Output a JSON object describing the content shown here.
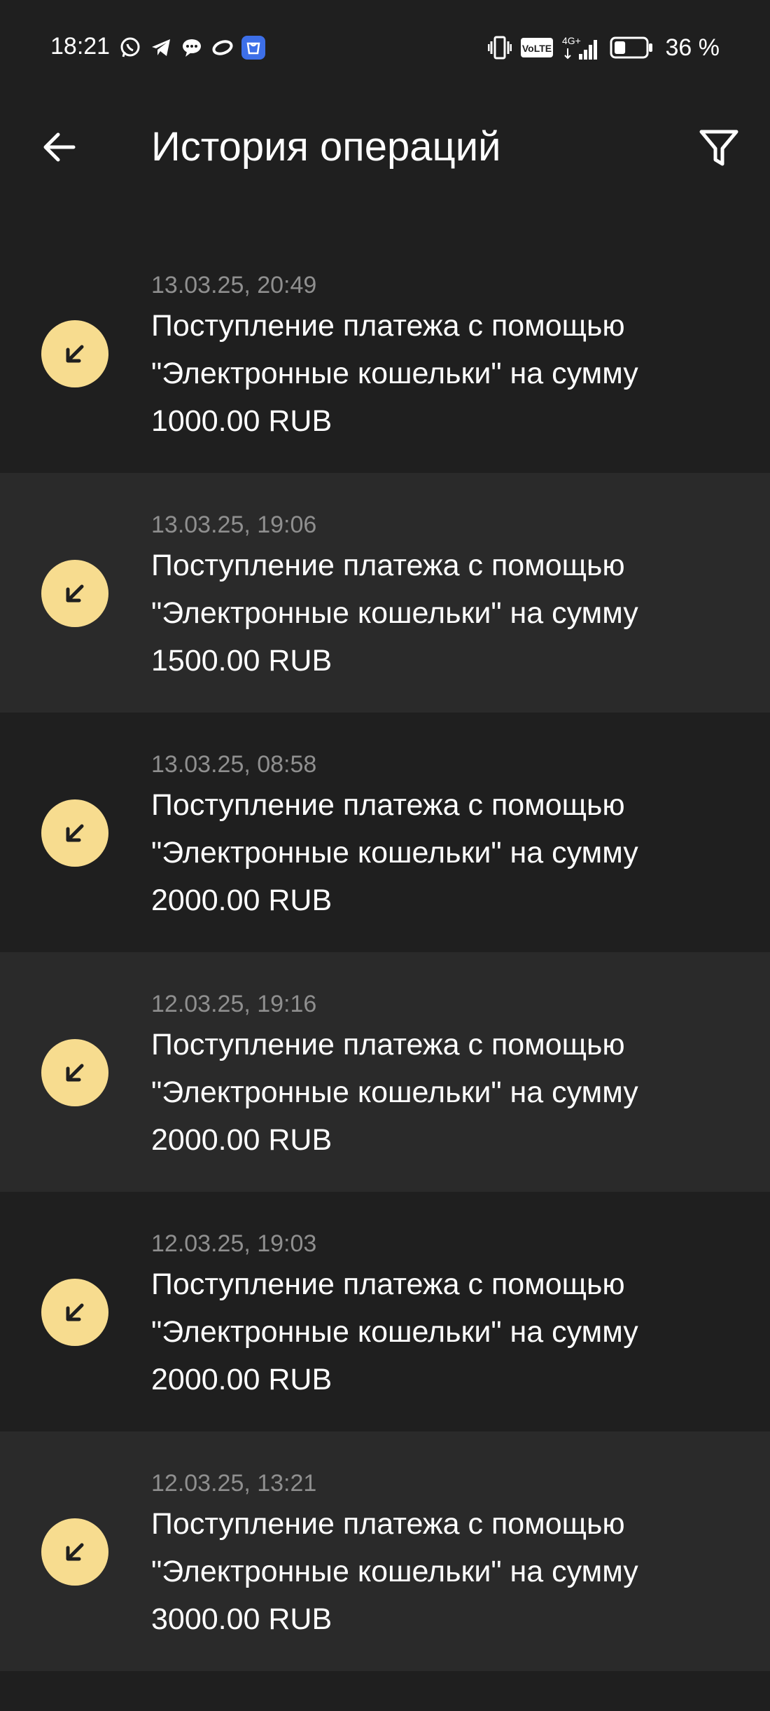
{
  "status_bar": {
    "time": "18:21",
    "left_icons": [
      "whatsapp-icon",
      "telegram-icon",
      "chat-bubble-icon",
      "ring-icon",
      "app-store-icon"
    ],
    "right_icons": [
      "vibrate-icon",
      "volte-icon",
      "4g-signal-icon",
      "battery-icon"
    ],
    "volte_label": "VoLTE",
    "network_label": "4G+",
    "battery_percent": "36 %",
    "battery_level": 0.36
  },
  "app_bar": {
    "title": "История операций",
    "back_icon": "arrow-left-icon",
    "filter_icon": "filter-icon"
  },
  "operations": [
    {
      "date": "13.03.25, 20:49",
      "description": "Поступление платежа с помощью \"Электронные кошельки\" на сумму 1000.00 RUB",
      "icon": "incoming-arrow-icon"
    },
    {
      "date": "13.03.25, 19:06",
      "description": "Поступление платежа с помощью \"Электронные кошельки\" на сумму 1500.00 RUB",
      "icon": "incoming-arrow-icon"
    },
    {
      "date": "13.03.25, 08:58",
      "description": "Поступление платежа с помощью \"Электронные кошельки\" на сумму 2000.00 RUB",
      "icon": "incoming-arrow-icon"
    },
    {
      "date": "12.03.25, 19:16",
      "description": "Поступление платежа с помощью \"Электронные кошельки\" на сумму 2000.00 RUB",
      "icon": "incoming-arrow-icon"
    },
    {
      "date": "12.03.25, 19:03",
      "description": "Поступление платежа с помощью \"Электронные кошельки\" на сумму 2000.00 RUB",
      "icon": "incoming-arrow-icon"
    },
    {
      "date": "12.03.25, 13:21",
      "description": "Поступление платежа с помощью \"Электронные кошельки\" на сумму 3000.00 RUB",
      "icon": "incoming-arrow-icon"
    }
  ],
  "colors": {
    "background": "#1f1f1f",
    "row_alt": "#2a2a2a",
    "accent": "#f7dc8f",
    "secondary_text": "#8f8f8f"
  }
}
